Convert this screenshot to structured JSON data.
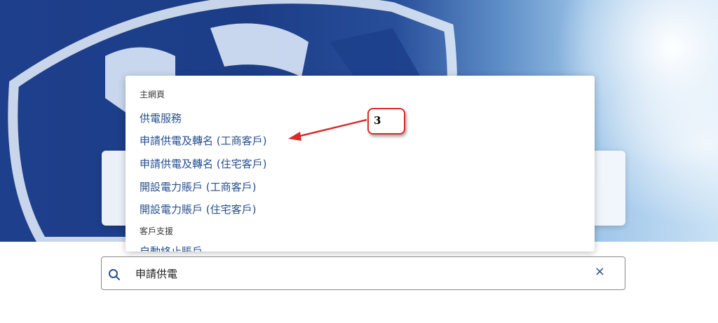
{
  "dropdown": {
    "groups": [
      {
        "label": "主網頁",
        "items": [
          "供電服務",
          "申請供電及轉名 (工商客戶)",
          "申請供電及轉名 (住宅客戶)",
          "開設電力賬戶 (工商客戶)",
          "開設電力賬戶 (住宅客戶)"
        ]
      },
      {
        "label": "客戶支援",
        "items": [
          "自動終止賬戶"
        ]
      }
    ]
  },
  "annotation": {
    "number": "3",
    "color": "#d92b2b"
  },
  "search": {
    "value": "申請供電",
    "clear_symbol": "×"
  },
  "colors": {
    "link": "#27508f",
    "hero_blue": "#1e3f8c"
  },
  "icons": {
    "search": "search-icon",
    "clear": "close-icon"
  }
}
